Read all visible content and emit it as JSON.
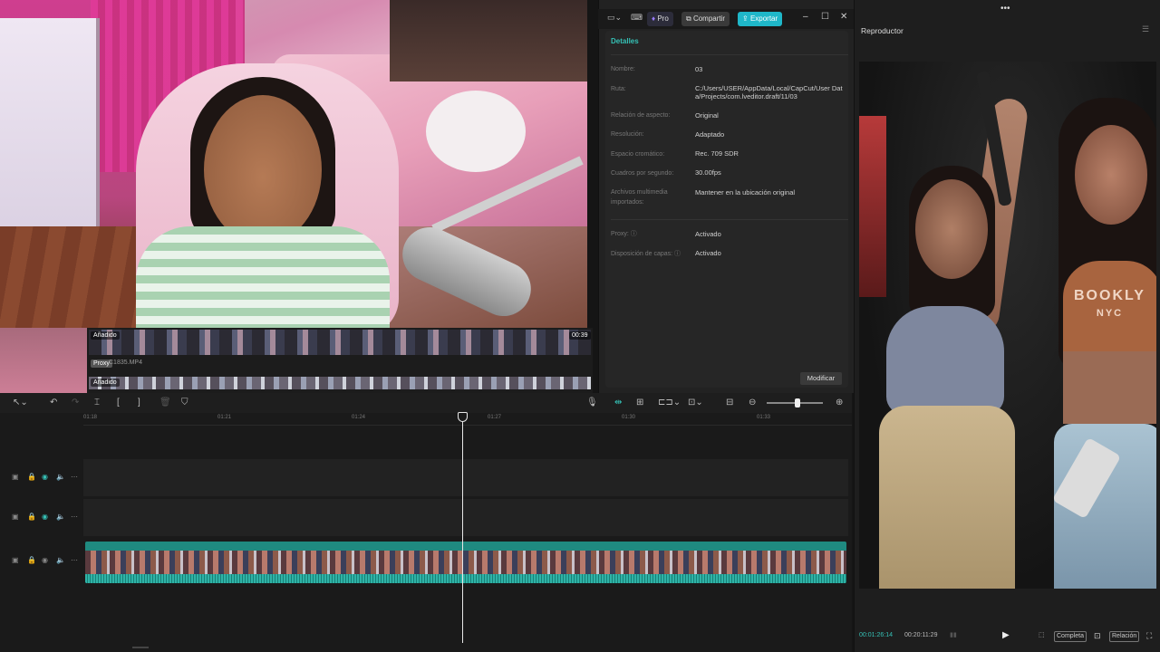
{
  "topbar": {
    "pro_label": "Pro",
    "share_label": "Compartir",
    "export_label": "Exportar"
  },
  "details": {
    "title": "Detalles",
    "rows": [
      {
        "label": "Nombre:",
        "value": "03"
      },
      {
        "label": "Ruta:",
        "value": "C:/Users/USER/AppData/Local/CapCut/User Data/Projects/com.lveditor.draft/11/03"
      },
      {
        "label": "Relación de aspecto:",
        "value": "Original"
      },
      {
        "label": "Resolución:",
        "value": "Adaptado"
      },
      {
        "label": "Espacio cromático:",
        "value": "Rec. 709 SDR"
      },
      {
        "label": "Cuadros por segundo:",
        "value": "30.00fps"
      },
      {
        "label": "Archivos multimedia importados:",
        "value": "Mantener en la ubicación original"
      },
      {
        "label": "Proxy:",
        "value": "Activado"
      },
      {
        "label": "Disposición de capas:",
        "value": "Activado"
      }
    ],
    "modify_label": "Modificar"
  },
  "media": {
    "added_label_1": "Añadido",
    "duration_1": "00:39",
    "proxy_tag": "Proxy",
    "file_name": "C1835.MP4",
    "added_label_2": "Añadido"
  },
  "timeline": {
    "ticks": [
      "01:18",
      "01:21",
      "01:24",
      "01:27",
      "01:30",
      "01:33"
    ]
  },
  "player": {
    "title": "Reproductor",
    "current_time": "00:01:26:14",
    "total_time": "00:20:11:29",
    "full_label": "Completa",
    "ratio_label": "Relación",
    "shirt_text": "BOOKLY",
    "shirt_text2": "NYC"
  },
  "colors": {
    "accent": "#35c1b6",
    "export_bg": "#1fb7c9",
    "clip": "#1f8a80"
  }
}
